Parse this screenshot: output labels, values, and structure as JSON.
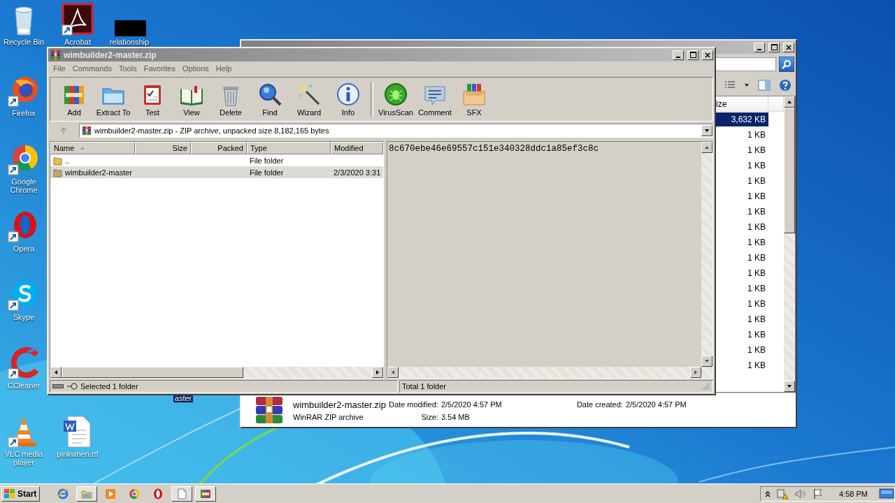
{
  "desktop_icons": [
    {
      "label": "Recycle Bin",
      "kind": "recycle",
      "selected": false
    },
    {
      "label": "Acrobat",
      "kind": "acrobat",
      "selected": false
    },
    {
      "label": "relationship",
      "kind": "redacted",
      "selected": false
    },
    {
      "label": "Firefox",
      "kind": "firefox",
      "selected": false
    },
    {
      "label": "Google Chrome",
      "kind": "chrome",
      "selected": false
    },
    {
      "label": "Opera",
      "kind": "opera",
      "selected": false
    },
    {
      "label": "Skype",
      "kind": "skype",
      "selected": false
    },
    {
      "label": "CCleaner",
      "kind": "ccleaner",
      "selected": false
    },
    {
      "label": "VLC media player",
      "kind": "vlc",
      "selected": false
    },
    {
      "label": "pinkwhen.rtf",
      "kind": "document",
      "selected": false
    },
    {
      "label": "aster",
      "kind": "hidden",
      "selected": true
    }
  ],
  "explorer": {
    "size_header": "ize",
    "sizes": [
      {
        "text": "3,632 KB",
        "selected": true
      },
      {
        "text": "1 KB",
        "selected": false
      },
      {
        "text": "1 KB",
        "selected": false
      },
      {
        "text": "1 KB",
        "selected": false
      },
      {
        "text": "1 KB",
        "selected": false
      },
      {
        "text": "1 KB",
        "selected": false
      },
      {
        "text": "1 KB",
        "selected": false
      },
      {
        "text": "1 KB",
        "selected": false
      },
      {
        "text": "1 KB",
        "selected": false
      },
      {
        "text": "1 KB",
        "selected": false
      },
      {
        "text": "1 KB",
        "selected": false
      },
      {
        "text": "1 KB",
        "selected": false
      },
      {
        "text": "1 KB",
        "selected": false
      },
      {
        "text": "1 KB",
        "selected": false
      },
      {
        "text": "1 KB",
        "selected": false
      },
      {
        "text": "1 KB",
        "selected": false
      },
      {
        "text": "1 KB",
        "selected": false
      }
    ],
    "details": {
      "name": "wimbuilder2-master.zip",
      "modified_label": "Date modified:",
      "modified": "2/5/2020 4:57 PM",
      "created_label": "Date created:",
      "created": "2/5/2020 4:57 PM",
      "type": "WinRAR ZIP archive",
      "size_label": "Size:",
      "size": "3.54 MB"
    }
  },
  "winrar": {
    "title": "wimbuilder2-master.zip",
    "menu": [
      "File",
      "Commands",
      "Tools",
      "Favorites",
      "Options",
      "Help"
    ],
    "toolbar_groups": [
      [
        {
          "label": "Add",
          "kind": "add"
        },
        {
          "label": "Extract To",
          "kind": "extract"
        },
        {
          "label": "Test",
          "kind": "test"
        },
        {
          "label": "View",
          "kind": "view"
        },
        {
          "label": "Delete",
          "kind": "delete"
        },
        {
          "label": "Find",
          "kind": "find"
        },
        {
          "label": "Wizard",
          "kind": "wizard"
        },
        {
          "label": "Info",
          "kind": "info"
        }
      ],
      [
        {
          "label": "VirusScan",
          "kind": "virusscan"
        },
        {
          "label": "Comment",
          "kind": "comment"
        },
        {
          "label": "SFX",
          "kind": "sfx"
        }
      ]
    ],
    "address": "wimbuilder2-master.zip - ZIP archive, unpacked size 8,182,165 bytes",
    "columns": [
      "Name",
      "Size",
      "Packed",
      "Type",
      "Modified"
    ],
    "files": [
      {
        "name": "..",
        "type": "File folder",
        "selected": false
      },
      {
        "name": "wimbuilder2-master",
        "type": "File folder",
        "modified": "2/3/2020 3:31",
        "selected": true
      }
    ],
    "comment": "8c670ebe46e69557c151e340328ddc1a85ef3c8c",
    "status_left": "Selected 1 folder",
    "status_right": "Total 1 folder"
  },
  "taskbar": {
    "start": "Start",
    "apps": [
      {
        "kind": "ie",
        "active": false
      },
      {
        "kind": "explorer",
        "active": true
      },
      {
        "kind": "media",
        "active": false
      },
      {
        "kind": "chrome",
        "active": false
      },
      {
        "kind": "opera",
        "active": false
      },
      {
        "kind": "notepad",
        "active": true
      },
      {
        "kind": "winrar",
        "active": true
      }
    ],
    "clock": "4:58 PM"
  }
}
